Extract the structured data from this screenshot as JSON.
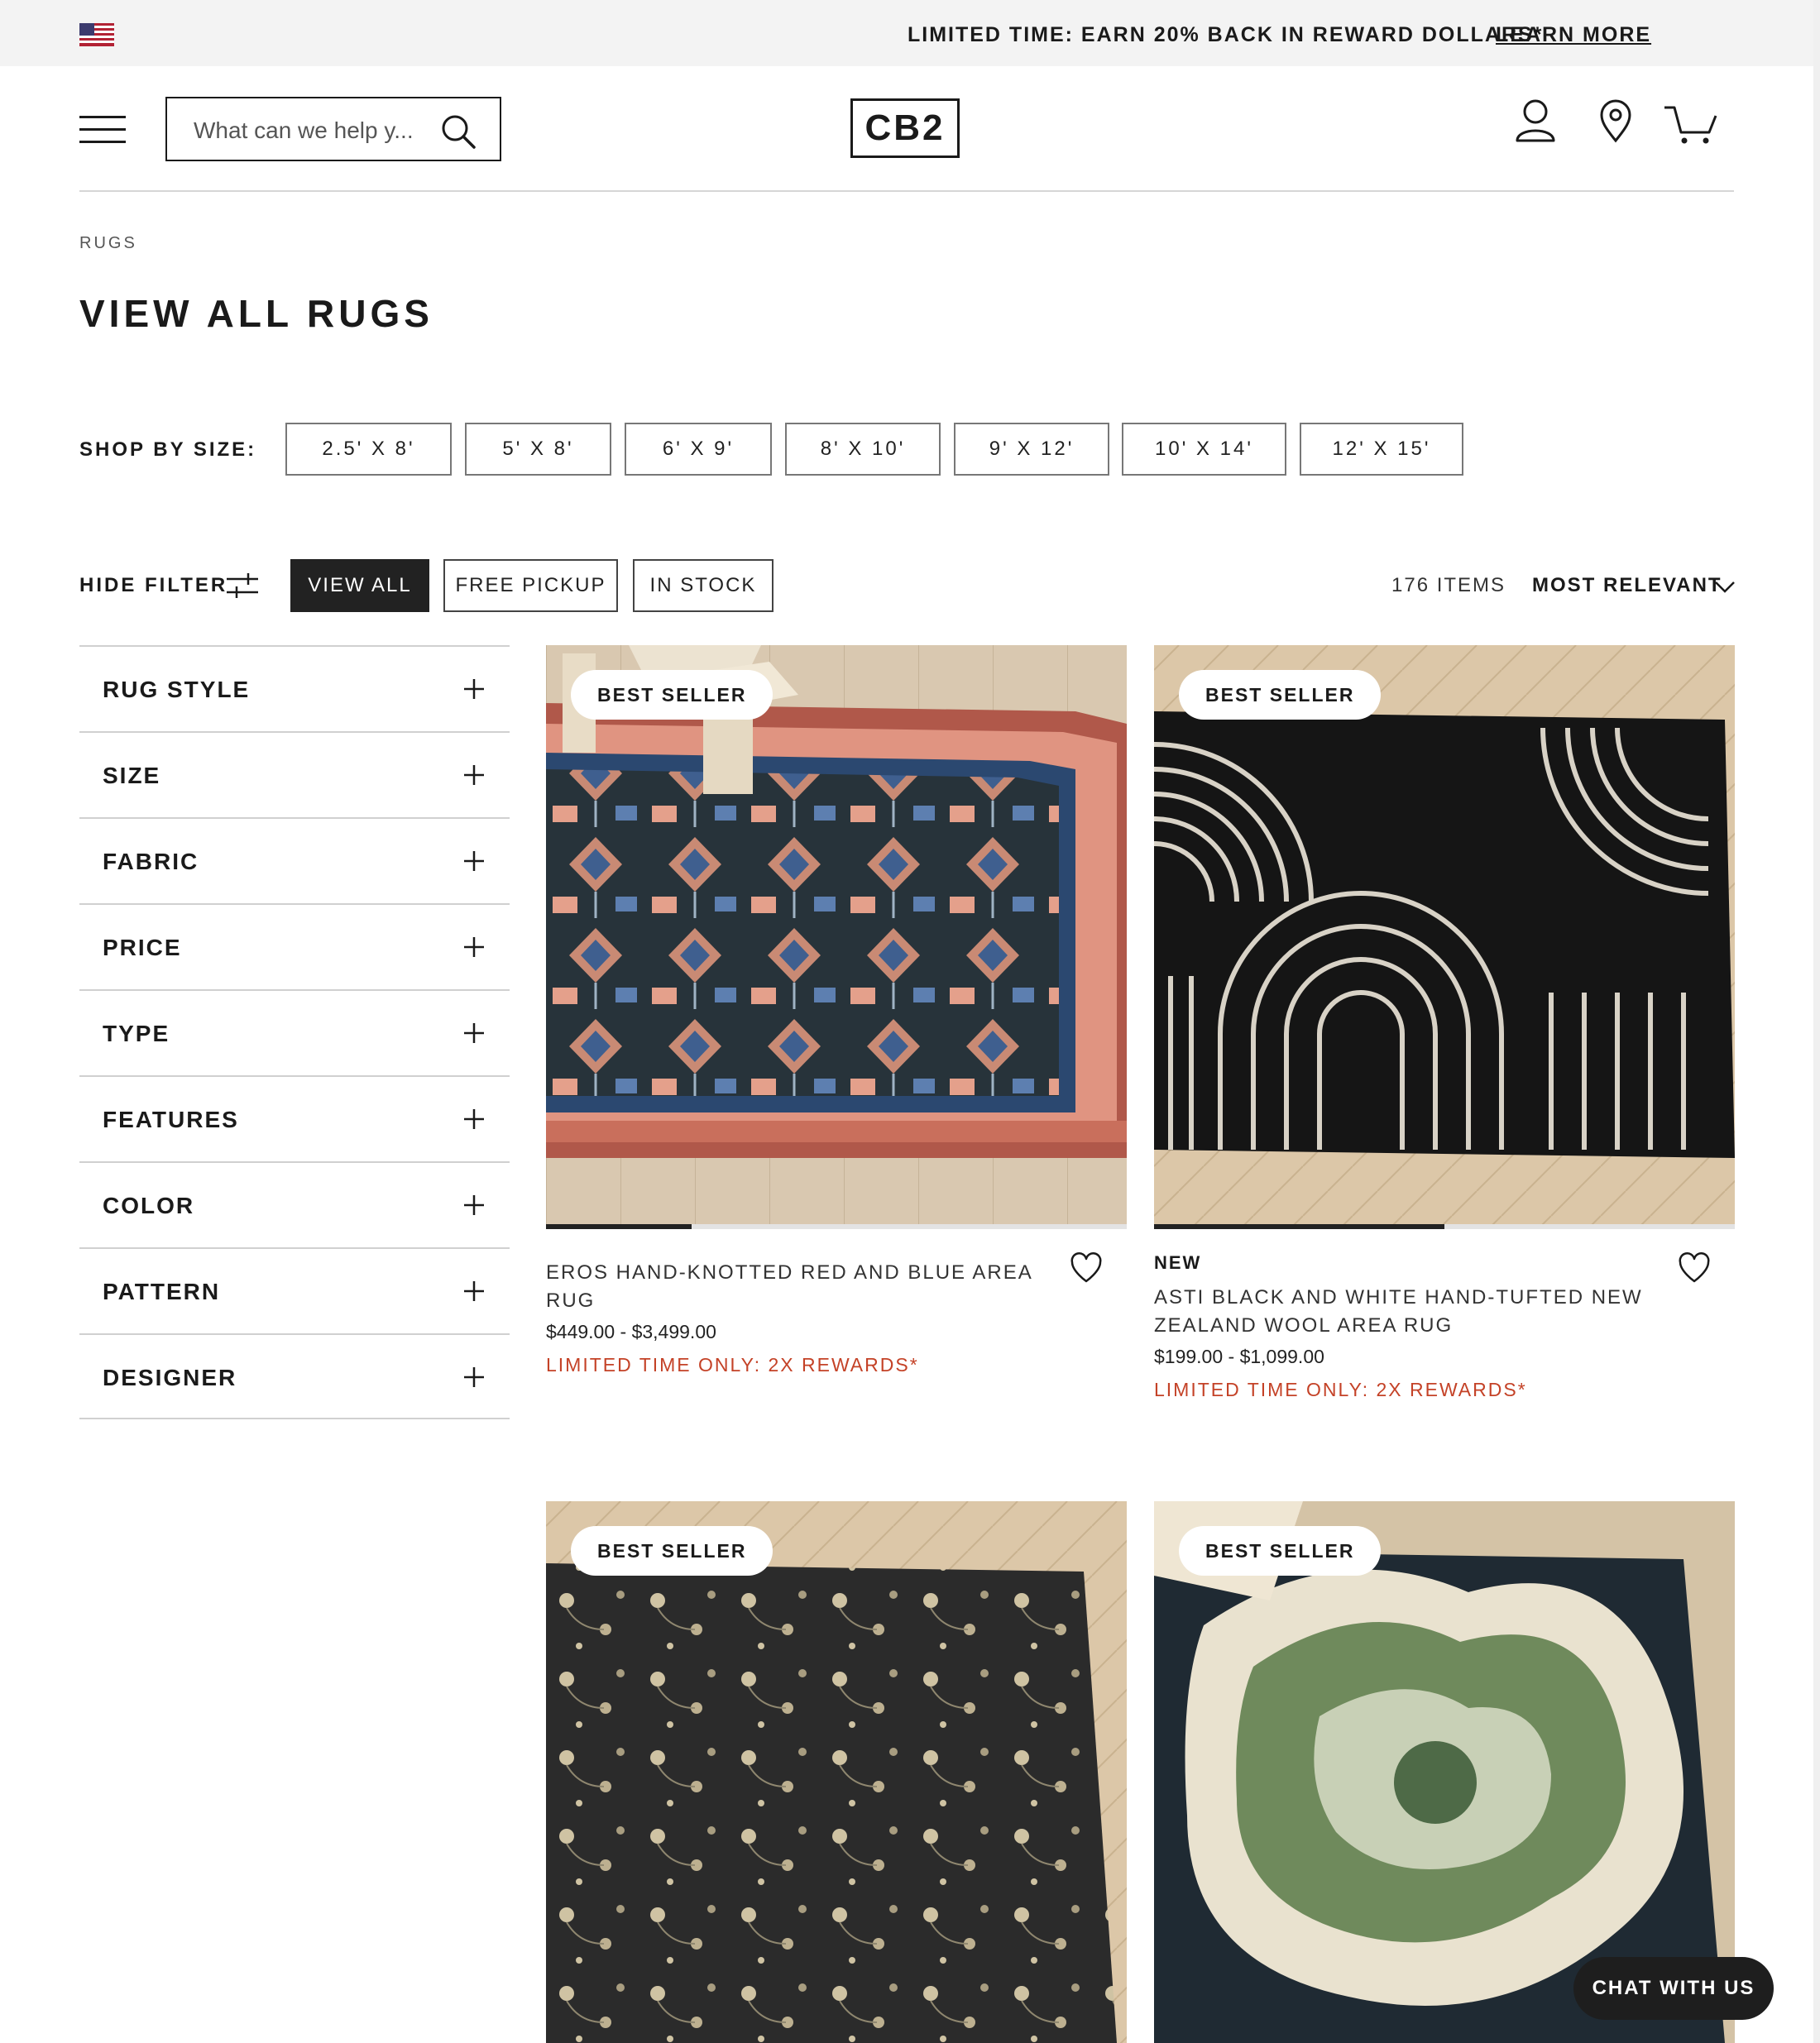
{
  "promo": {
    "text": "LIMITED TIME: EARN 20% BACK IN REWARD DOLLARS*",
    "link": "LEARN MORE"
  },
  "header": {
    "search_placeholder": "What can we help y...",
    "logo": "CB2"
  },
  "breadcrumb": "RUGS",
  "page_title": "VIEW ALL RUGS",
  "shop_by_size": {
    "label": "SHOP BY SIZE:",
    "sizes": [
      "2.5' X 8'",
      "5' X 8'",
      "6' X 9'",
      "8' X 10'",
      "9' X 12'",
      "10' X 14'",
      "12' X 15'"
    ]
  },
  "filter_bar": {
    "hide_filter": "HIDE FILTER",
    "chips": [
      "VIEW ALL",
      "FREE PICKUP",
      "IN STOCK"
    ],
    "active_chip": "VIEW ALL",
    "items_count": "176 ITEMS",
    "sort_label": "MOST RELEVANT"
  },
  "facets": [
    "RUG STYLE",
    "SIZE",
    "FABRIC",
    "PRICE",
    "TYPE",
    "FEATURES",
    "COLOR",
    "PATTERN",
    "DESIGNER"
  ],
  "products": [
    {
      "badge": "BEST SELLER",
      "name": "EROS HAND-KNOTTED RED AND BLUE AREA RUG",
      "price": "$449.00 - $3,499.00",
      "rewards": "LIMITED TIME ONLY: 2X REWARDS*",
      "image_progress": 0.25
    },
    {
      "badge": "BEST SELLER",
      "tag": "NEW",
      "name": "ASTI BLACK AND WHITE HAND-TUFTED NEW ZEALAND WOOL AREA RUG",
      "price": "$199.00 - $1,099.00",
      "rewards": "LIMITED TIME ONLY: 2X REWARDS*",
      "image_progress": 0.5
    },
    {
      "badge": "BEST SELLER"
    },
    {
      "badge": "BEST SELLER"
    }
  ],
  "chat": "CHAT WITH US",
  "colors": {
    "accent_dark": "#222222",
    "rewards_red": "#c44227",
    "promo_bg": "#f3f3f3"
  }
}
